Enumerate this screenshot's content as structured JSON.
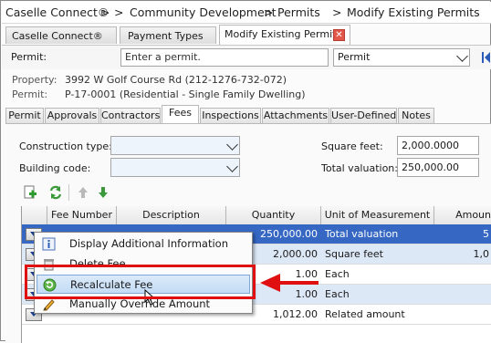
{
  "breadcrumb": {
    "items": [
      "Caselle Connect®",
      "Community Development",
      "Permits",
      "Modify Existing Permits"
    ],
    "separator": ">"
  },
  "tabs": [
    {
      "label": "Caselle Connect®",
      "active": false
    },
    {
      "label": "Payment Types",
      "active": false
    },
    {
      "label": "Modify Existing Permits",
      "active": true
    }
  ],
  "permit_row": {
    "label": "Permit:",
    "placeholder": "Enter a permit.",
    "type_value": "Permit"
  },
  "info": {
    "property_label": "Property:",
    "property_value": "3992 W Golf Course Rd (212-1276-732-072)",
    "permit_label": "Permit:",
    "permit_value": "P-17-0001 (Residential - Single Family Dwelling)"
  },
  "subtabs": [
    "Permit",
    "Approvals",
    "Contractors",
    "Fees",
    "Inspections",
    "Attachments",
    "User-Defined",
    "Notes"
  ],
  "active_subtab": "Fees",
  "form": {
    "construction_type_label": "Construction type:",
    "construction_type_value": "",
    "building_code_label": "Building code:",
    "building_code_value": "",
    "square_feet_label": "Square feet:",
    "square_feet_value": "2,000.0000",
    "total_valuation_label": "Total valuation:",
    "total_valuation_value": "250,000.00"
  },
  "grid": {
    "columns": [
      "Fee Number",
      "Description",
      "Quantity",
      "Unit of Measurement",
      "Amoun"
    ],
    "rows": [
      {
        "fee": "",
        "desc": "",
        "qty": "250,000.00",
        "unit": "Total valuation",
        "amount": "5",
        "selected": true
      },
      {
        "fee": "",
        "desc": "",
        "qty": "2,000.00",
        "unit": "Square feet",
        "amount": "1,0",
        "selected": false
      },
      {
        "fee": "",
        "desc": "",
        "qty": "1.00",
        "unit": "Each",
        "amount": "",
        "selected": false
      },
      {
        "fee": "",
        "desc": "",
        "qty": "1.00",
        "unit": "Each",
        "amount": "",
        "selected": false
      },
      {
        "fee": "",
        "desc": "",
        "qty": "1,012.00",
        "unit": "Related amount",
        "amount": "",
        "selected": false
      }
    ]
  },
  "context_menu": {
    "items": [
      {
        "label": "Display Additional Information",
        "icon": "info-icon"
      },
      {
        "label": "Delete Fee",
        "icon": "delete-icon"
      },
      {
        "label": "Recalculate Fee",
        "icon": "recalculate-icon",
        "highlighted": true
      },
      {
        "label": "Manually Override Amount",
        "icon": "pencil-icon"
      }
    ]
  },
  "colors": {
    "selection": "#3567c3",
    "alt_row": "#dde8f7",
    "callout": "#e01010",
    "menu_highlight": "#c4dcf5"
  }
}
